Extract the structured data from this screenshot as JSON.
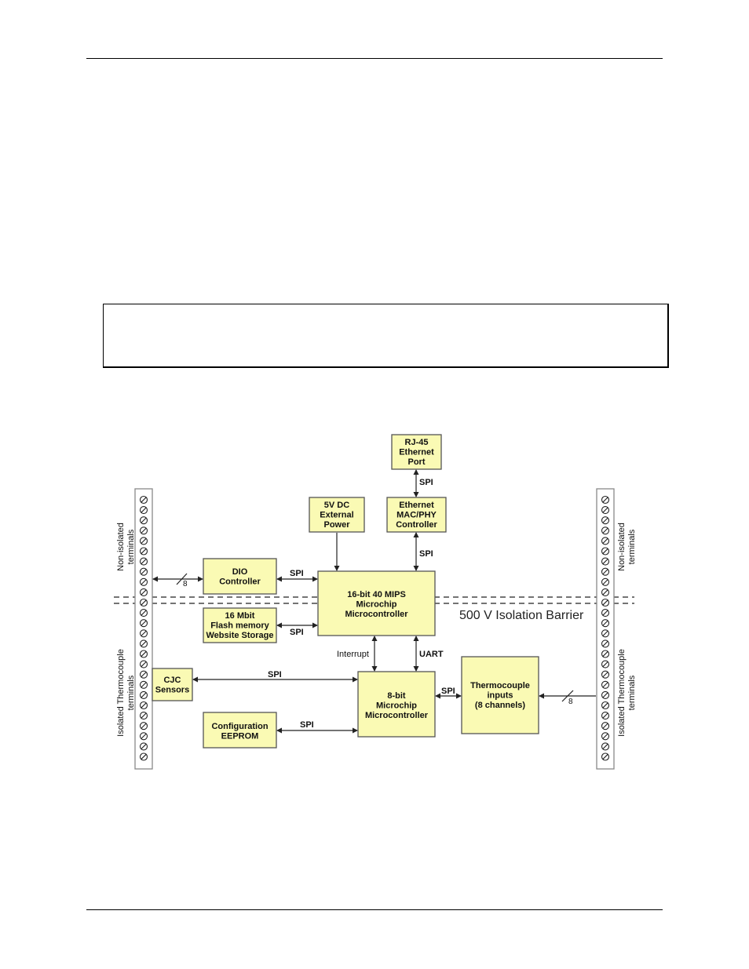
{
  "diagram": {
    "blocks": {
      "rj45": [
        "RJ-45",
        "Ethernet",
        "Port"
      ],
      "power": [
        "5V DC",
        "External",
        "Power"
      ],
      "ethernet_mac": [
        "Ethernet",
        "MAC/PHY",
        "Controller"
      ],
      "dio": [
        "DIO",
        "Controller"
      ],
      "mcu16": [
        "16-bit 40 MIPS",
        "Microchip",
        "Microcontroller"
      ],
      "flash": [
        "16 Mbit",
        "Flash memory",
        "Website Storage"
      ],
      "cjc": [
        "CJC",
        "Sensors"
      ],
      "mcu8": [
        "8-bit",
        "Microchip",
        "Microcontroller"
      ],
      "thermocouple": [
        "Thermocouple",
        "inputs",
        "(8 channels)"
      ],
      "eeprom": [
        "Configuration",
        "EEPROM"
      ]
    },
    "signals": {
      "rj45_mac": "SPI",
      "mac_mcu16": "SPI",
      "dio_mcu16": "SPI",
      "flash_mcu16": "SPI",
      "interrupt": "Interrupt",
      "uart": "UART",
      "cjc_mcu8": "SPI",
      "eeprom_mcu8": "SPI",
      "tc_mcu8": "SPI",
      "bus_width_left": "8",
      "bus_width_right": "8"
    },
    "barrier_label": "500 V Isolation Barrier",
    "left_labels": {
      "non_isolated": [
        "Non-isolated",
        "terminals"
      ],
      "isolated": [
        "Isolated Thermocouple",
        "terminals"
      ]
    },
    "right_labels": {
      "non_isolated": [
        "Non-isolated",
        "terminals"
      ],
      "isolated": [
        "Isolated Thermocouple",
        "terminals"
      ]
    },
    "terminal_count": 26,
    "colors": {
      "block_fill": "#fafab4",
      "block_border": "#555555"
    }
  }
}
